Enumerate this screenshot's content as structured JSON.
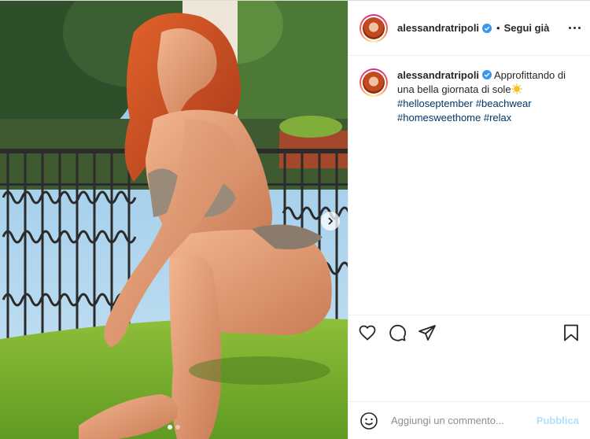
{
  "post": {
    "author": {
      "username": "alessandratripoli",
      "verified": true,
      "follow_separator": "•",
      "follow_label": "Segui già"
    },
    "caption": {
      "username": "alessandratripoli",
      "text": "Approfittando di una bella giornata di sole",
      "hashtags": [
        "#helloseptember",
        "#beachwear",
        "#homesweethome",
        "#relax"
      ]
    },
    "carousel": {
      "total": 2,
      "current": 1
    },
    "actions": {
      "like_icon": "heart-icon",
      "comment_icon": "comment-icon",
      "share_icon": "paper-plane-icon",
      "save_icon": "bookmark-icon"
    },
    "comment_box": {
      "placeholder": "Aggiungi un commento...",
      "publish_label": "Pubblica"
    }
  },
  "colors": {
    "text": "#262626",
    "hashtag": "#00376b",
    "verified": "#3897f0",
    "publish_disabled": "#b2dffc",
    "border": "#efefef"
  }
}
